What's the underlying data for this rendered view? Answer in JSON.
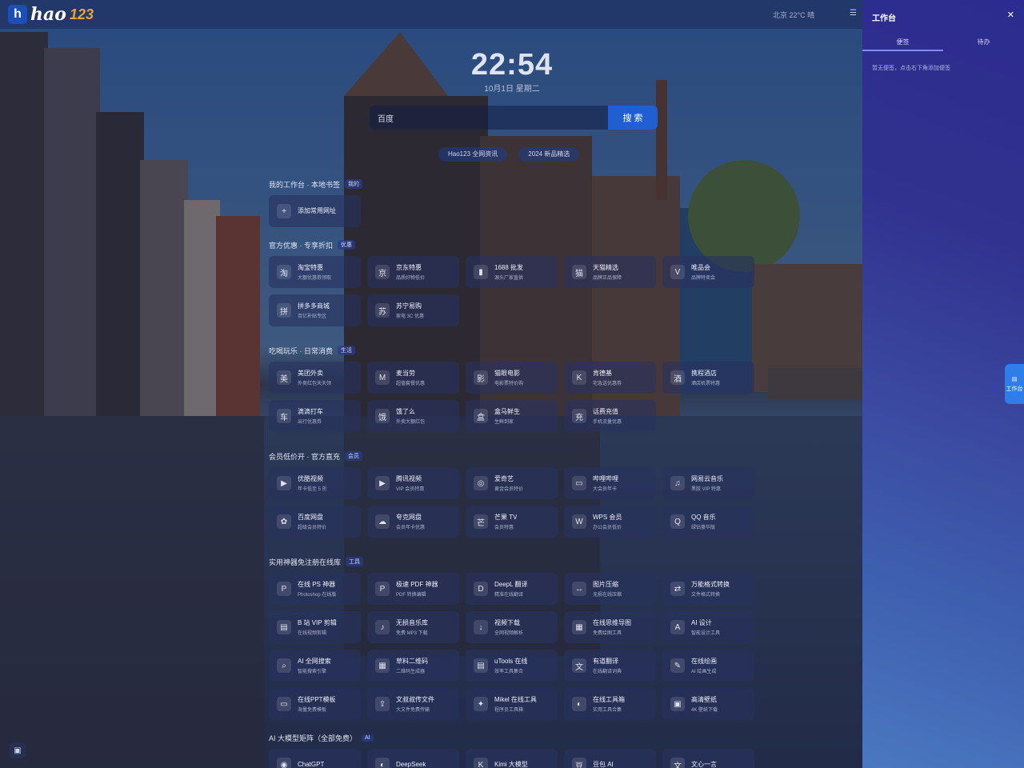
{
  "header": {
    "logo_text": "hao",
    "logo_num": "123",
    "weather": "北京 22°C 晴",
    "menu_icon": "menu-icon"
  },
  "clock": {
    "time": "22:54",
    "date": "10月1日 星期二"
  },
  "search": {
    "engine": "百度",
    "placeholder": "",
    "button": "搜 索"
  },
  "chips": [
    "Hao123 全网资讯",
    "2024 新品精选"
  ],
  "sections": [
    {
      "title": "我的工作台 · 本地书签",
      "tag": "我的",
      "cards": [
        {
          "icon": "plus-icon",
          "glyph": "+",
          "name": "添加常用网址",
          "desc": ""
        }
      ]
    },
    {
      "title": "官方优惠 · 专享折扣",
      "tag": "优惠",
      "cards": [
        {
          "icon": "taobao-icon",
          "glyph": "淘",
          "name": "淘宝特惠",
          "desc": "大额优惠券领取"
        },
        {
          "icon": "jd-icon",
          "glyph": "京",
          "name": "京东特惠",
          "desc": "品质好物低价"
        },
        {
          "icon": "chart-icon",
          "glyph": "▮",
          "name": "1688 批发",
          "desc": "源头厂家直供"
        },
        {
          "icon": "cat-icon",
          "glyph": "猫",
          "name": "天猫精选",
          "desc": "品牌正品保障"
        },
        {
          "icon": "vip-icon",
          "glyph": "V",
          "name": "唯品会",
          "desc": "品牌特卖会"
        },
        {
          "icon": "store-icon",
          "glyph": "拼",
          "name": "拼多多商城",
          "desc": "百亿补贴专区"
        },
        {
          "icon": "suning-icon",
          "glyph": "苏",
          "name": "苏宁易购",
          "desc": "家电 3C 优惠"
        }
      ]
    },
    {
      "title": "吃喝玩乐 · 日常消费",
      "tag": "生活",
      "cards": [
        {
          "icon": "bag-icon",
          "glyph": "美",
          "name": "美团外卖",
          "desc": "外卖红包天天领"
        },
        {
          "icon": "mcdonalds-icon",
          "glyph": "M",
          "name": "麦当劳",
          "desc": "超值套餐优惠"
        },
        {
          "icon": "ticket-icon",
          "glyph": "影",
          "name": "猫眼电影",
          "desc": "电影票特价购"
        },
        {
          "icon": "kfc-icon",
          "glyph": "K",
          "name": "肯德基",
          "desc": "宅急送优惠券"
        },
        {
          "icon": "hotel-icon",
          "glyph": "酒",
          "name": "携程酒店",
          "desc": "酒店机票特惠"
        },
        {
          "icon": "car-icon",
          "glyph": "车",
          "name": "滴滴打车",
          "desc": "出行优惠券"
        },
        {
          "icon": "food-icon",
          "glyph": "饿",
          "name": "饿了么",
          "desc": "外卖大额红包"
        },
        {
          "icon": "bag2-icon",
          "glyph": "盒",
          "name": "盒马鲜生",
          "desc": "生鲜到家"
        },
        {
          "icon": "wifi-icon",
          "glyph": "充",
          "name": "话费充值",
          "desc": "手机流量优惠"
        }
      ]
    },
    {
      "title": "会员低价开 · 官方直充",
      "tag": "会员",
      "cards": [
        {
          "icon": "play-icon",
          "glyph": "▶",
          "name": "优酷视频",
          "desc": "年卡低至 5 折"
        },
        {
          "icon": "video-icon",
          "glyph": "▶",
          "name": "腾讯视频",
          "desc": "VIP 会员特惠"
        },
        {
          "icon": "circle-icon",
          "glyph": "◎",
          "name": "爱奇艺",
          "desc": "黄金会员特价"
        },
        {
          "icon": "tv-icon",
          "glyph": "▭",
          "name": "哔哩哔哩",
          "desc": "大会员年卡"
        },
        {
          "icon": "music-icon",
          "glyph": "♫",
          "name": "网易云音乐",
          "desc": "黑胶 VIP 特惠"
        },
        {
          "icon": "paw-icon",
          "glyph": "✿",
          "name": "百度网盘",
          "desc": "超级会员特价"
        },
        {
          "icon": "cloud-icon",
          "glyph": "☁",
          "name": "夸克网盘",
          "desc": "会员年卡优惠"
        },
        {
          "icon": "mango-icon",
          "glyph": "芒",
          "name": "芒果 TV",
          "desc": "会员特惠"
        },
        {
          "icon": "wps-icon",
          "glyph": "W",
          "name": "WPS 会员",
          "desc": "办公会员低价"
        },
        {
          "icon": "qq-icon",
          "glyph": "Q",
          "name": "QQ 音乐",
          "desc": "绿钻豪华版"
        }
      ]
    },
    {
      "title": "实用神器免注册在线库",
      "tag": "工具",
      "cards": [
        {
          "icon": "ps-icon",
          "glyph": "P",
          "name": "在线 PS 神器",
          "desc": "Photoshop 在线版"
        },
        {
          "icon": "pdf-icon",
          "glyph": "P",
          "name": "极速 PDF 神器",
          "desc": "PDF 转换编辑"
        },
        {
          "icon": "deepl-icon",
          "glyph": "D",
          "name": "DeepL 翻译",
          "desc": "精准在线翻译"
        },
        {
          "icon": "compress-icon",
          "glyph": "↔",
          "name": "图片压缩",
          "desc": "无损在线压缩"
        },
        {
          "icon": "convert-icon",
          "glyph": "⇄",
          "name": "万能格式转换",
          "desc": "文件格式转换"
        },
        {
          "icon": "film-icon",
          "glyph": "▤",
          "name": "B 站 VIP 剪辑",
          "desc": "在线视频剪辑"
        },
        {
          "icon": "note-icon",
          "glyph": "♪",
          "name": "无损音乐库",
          "desc": "免费 MP3 下载"
        },
        {
          "icon": "download-icon",
          "glyph": "↓",
          "name": "视频下载",
          "desc": "全网视频解析"
        },
        {
          "icon": "qrcode-icon",
          "glyph": "▦",
          "name": "在线思维导图",
          "desc": "免费绘图工具"
        },
        {
          "icon": "ai-icon",
          "glyph": "A",
          "name": "AI 设计",
          "desc": "智能设计工具"
        },
        {
          "icon": "search-icon",
          "glyph": "⌕",
          "name": "AI 全网搜索",
          "desc": "智能搜索引擎"
        },
        {
          "icon": "grid-icon",
          "glyph": "▦",
          "name": "草料二维码",
          "desc": "二维码生成器"
        },
        {
          "icon": "tools-icon",
          "glyph": "▤",
          "name": "uTools 在线",
          "desc": "效率工具集合"
        },
        {
          "icon": "translate-icon",
          "glyph": "文",
          "name": "有道翻译",
          "desc": "在线翻译词典"
        },
        {
          "icon": "pen-icon",
          "glyph": "✎",
          "name": "在线绘画",
          "desc": "AI 绘画生成"
        },
        {
          "icon": "monitor-icon",
          "glyph": "▭",
          "name": "在线PPT模板",
          "desc": "海量免费模板"
        },
        {
          "icon": "upload-icon",
          "glyph": "⇪",
          "name": "文叔叔传文件",
          "desc": "大文件免费传输"
        },
        {
          "icon": "wrench-icon",
          "glyph": "✦",
          "name": "Mikel 在线工具",
          "desc": "程序员工具箱"
        },
        {
          "icon": "chat-icon",
          "glyph": "◐",
          "name": "在线工具箱",
          "desc": "实用工具合集"
        },
        {
          "icon": "image-icon",
          "glyph": "▣",
          "name": "高清壁纸",
          "desc": "4K 壁纸下载"
        }
      ]
    },
    {
      "title": "AI 大模型矩阵（全部免费）",
      "tag": "AI",
      "cards": [
        {
          "icon": "chatgpt-icon",
          "glyph": "◉",
          "name": "ChatGPT",
          "desc": ""
        },
        {
          "icon": "deepseek-icon",
          "glyph": "◐",
          "name": "DeepSeek",
          "desc": ""
        },
        {
          "icon": "kimi-icon",
          "glyph": "K",
          "name": "Kimi 大模型",
          "desc": ""
        },
        {
          "icon": "doubao-icon",
          "glyph": "豆",
          "name": "豆包 AI",
          "desc": ""
        },
        {
          "icon": "wenxin-icon",
          "glyph": "文",
          "name": "文心一言",
          "desc": ""
        }
      ]
    }
  ],
  "panel": {
    "title": "工作台",
    "close_icon": "close-icon",
    "tabs": [
      "便签",
      "待办"
    ],
    "empty_text": "暂无便签，点击右下角添加便签"
  },
  "side_float": {
    "icon": "document-icon",
    "label": "工作台"
  },
  "corner": {
    "icon": "wallpaper-icon"
  },
  "colors": {
    "accent": "#1f5fd1",
    "panel_top": "#2c2b8f",
    "panel_bottom": "#4a78c0",
    "logo_accent": "#e8a62c"
  }
}
